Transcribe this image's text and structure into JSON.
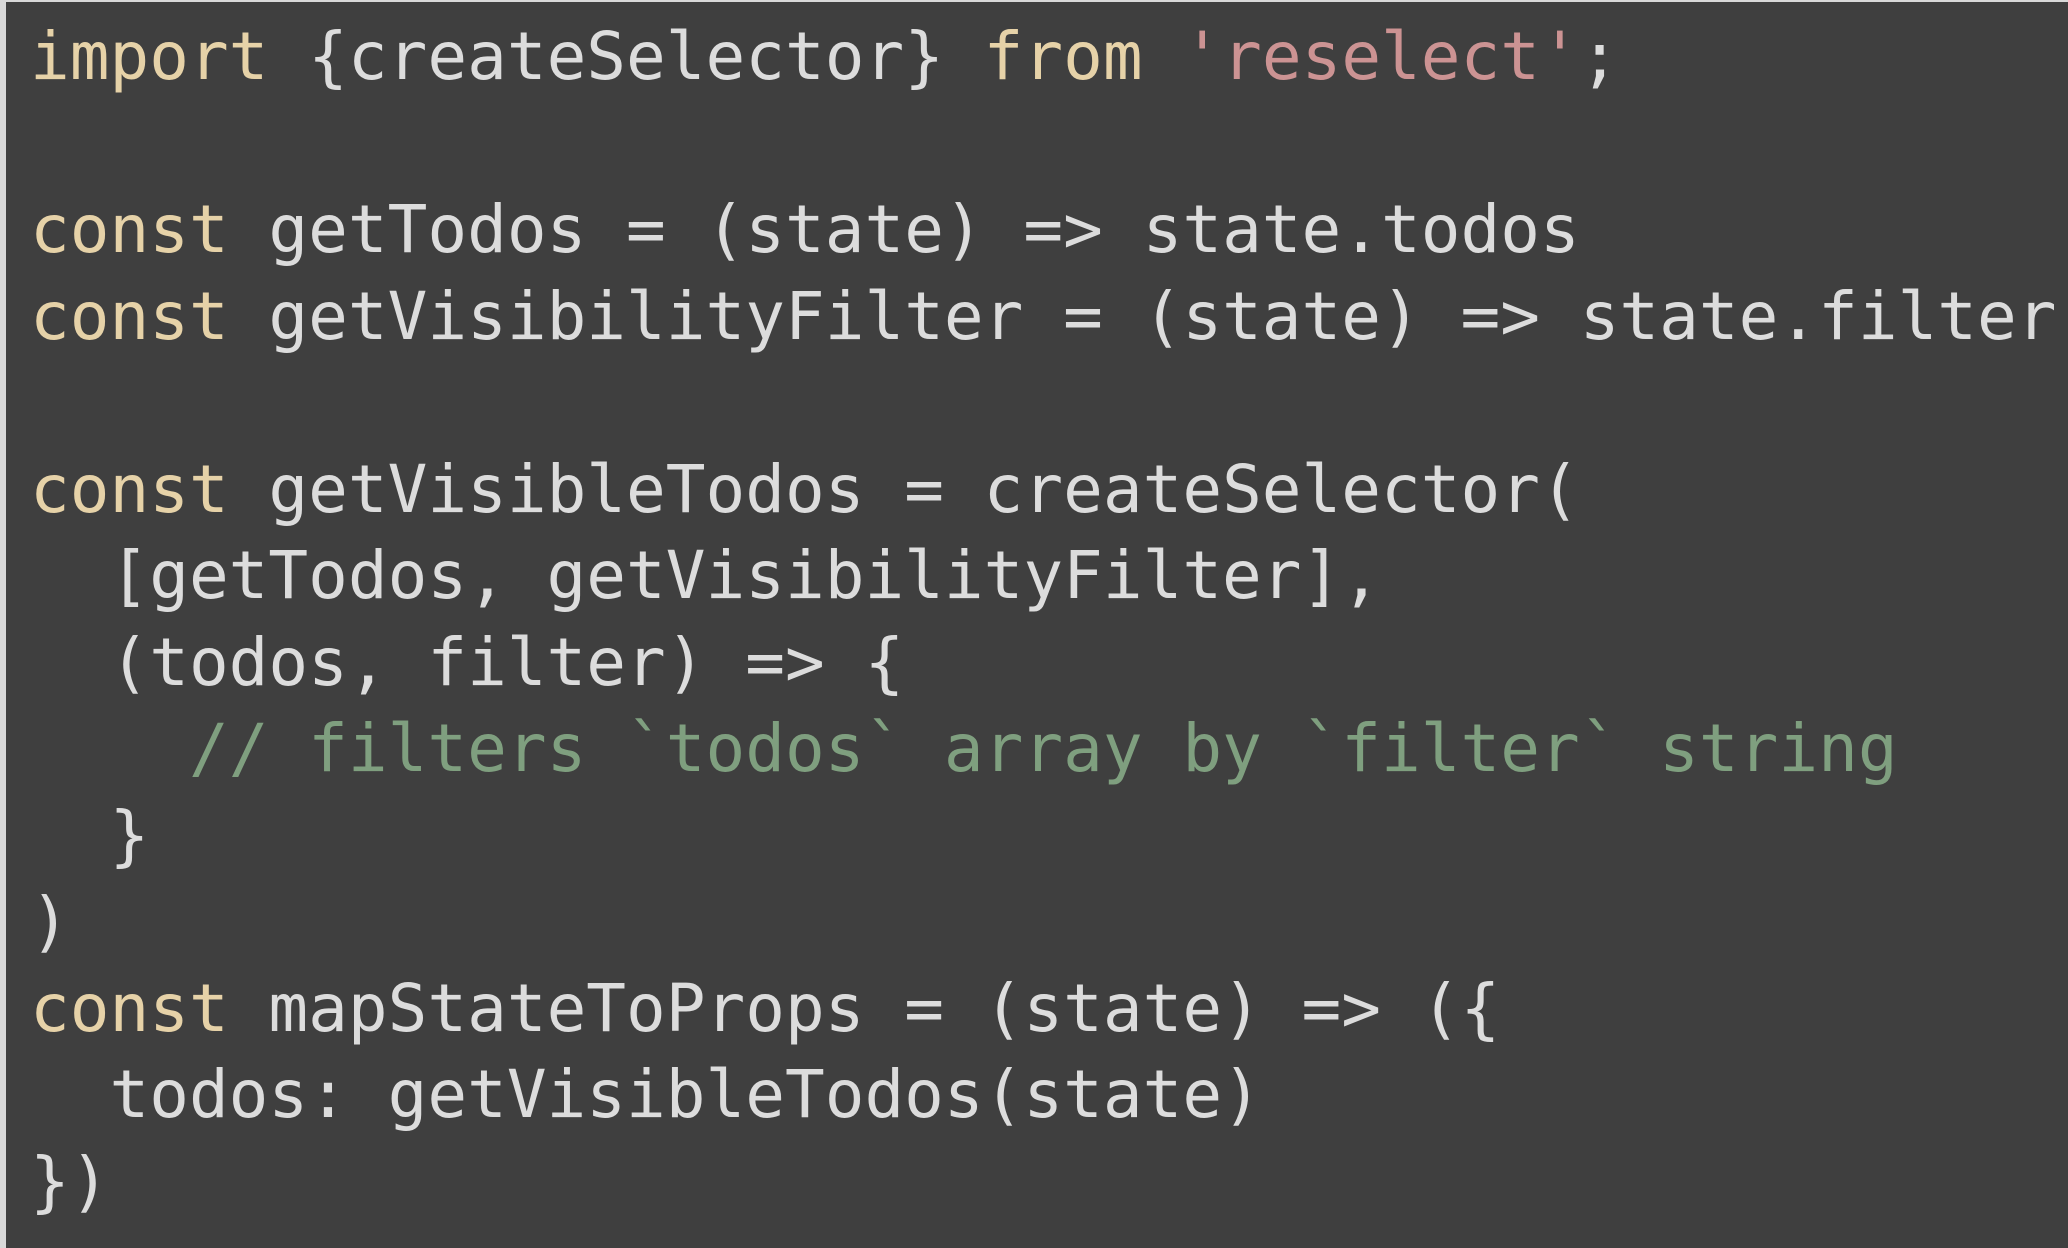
{
  "colors": {
    "background": "#3f3f3f",
    "keyword": "#e6d2a8",
    "string": "#cc9393",
    "comment": "#7f9f7f",
    "text": "#dcdcdc"
  },
  "code": {
    "lines": [
      [
        {
          "t": "kw",
          "v": "import"
        },
        {
          "t": "id",
          "v": " {createSelector} "
        },
        {
          "t": "kw",
          "v": "from"
        },
        {
          "t": "id",
          "v": " "
        },
        {
          "t": "str",
          "v": "'reselect'"
        },
        {
          "t": "id",
          "v": ";"
        }
      ],
      [],
      [
        {
          "t": "kw",
          "v": "const"
        },
        {
          "t": "id",
          "v": " getTodos = (state) => state.todos"
        }
      ],
      [
        {
          "t": "kw",
          "v": "const"
        },
        {
          "t": "id",
          "v": " getVisibilityFilter = (state) => state.filter"
        }
      ],
      [],
      [
        {
          "t": "kw",
          "v": "const"
        },
        {
          "t": "id",
          "v": " getVisibleTodos = createSelector("
        }
      ],
      [
        {
          "t": "id",
          "v": "  [getTodos, getVisibilityFilter],"
        }
      ],
      [
        {
          "t": "id",
          "v": "  (todos, filter) => {"
        }
      ],
      [
        {
          "t": "id",
          "v": "    "
        },
        {
          "t": "cm",
          "v": "// filters `todos` array by `filter` string"
        }
      ],
      [
        {
          "t": "id",
          "v": "  }"
        }
      ],
      [
        {
          "t": "id",
          "v": ")"
        }
      ],
      [
        {
          "t": "kw",
          "v": "const"
        },
        {
          "t": "id",
          "v": " mapStateToProps = (state) => ({"
        }
      ],
      [
        {
          "t": "id",
          "v": "  todos: getVisibleTodos(state)"
        }
      ],
      [
        {
          "t": "id",
          "v": "})"
        }
      ]
    ]
  }
}
